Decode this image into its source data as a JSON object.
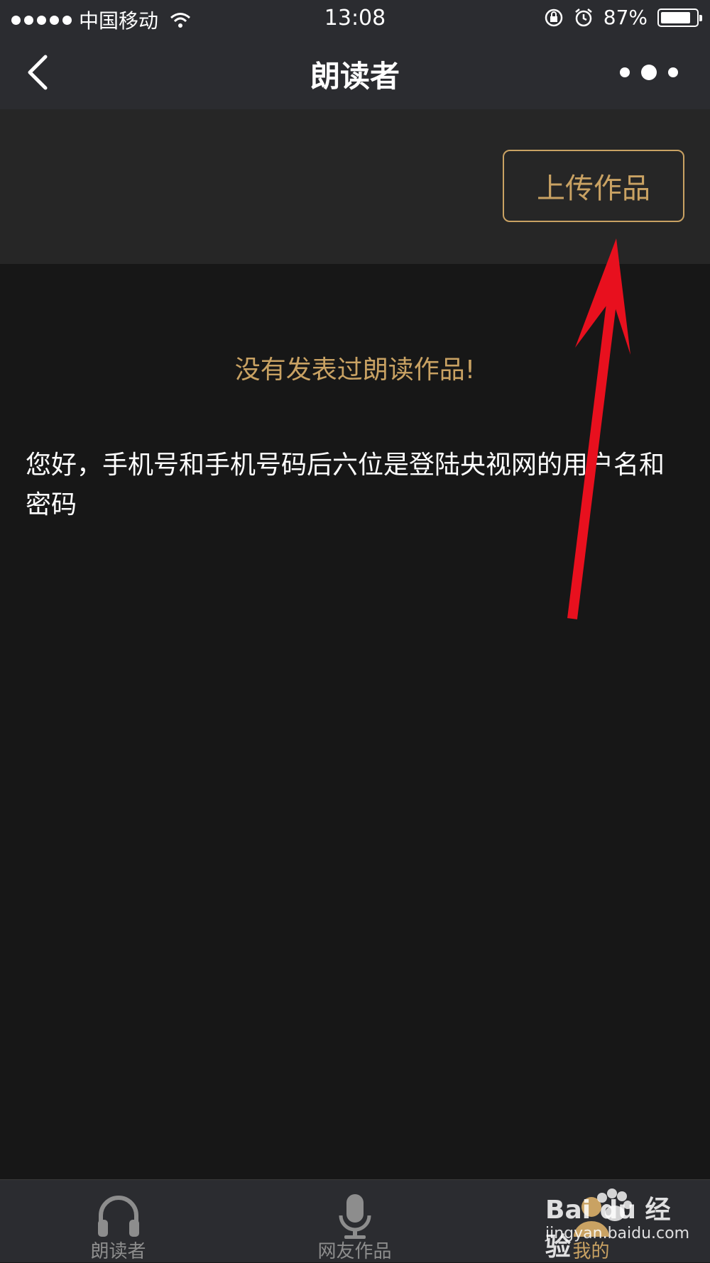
{
  "status_bar": {
    "carrier": "中国移动",
    "time": "13:08",
    "battery_percent": "87%",
    "battery_level": 0.87
  },
  "nav": {
    "title": "朗读者"
  },
  "upload": {
    "label": "上传作品"
  },
  "main": {
    "empty_message": "没有发表过朗读作品!",
    "notice": "您好，手机号和手机号码后六位是登陆央视网的用户名和密码"
  },
  "tabs": [
    {
      "label": "朗读者",
      "icon": "headphones-icon",
      "active": false
    },
    {
      "label": "网友作品",
      "icon": "microphone-icon",
      "active": false
    },
    {
      "label": "我的",
      "icon": "user-icon",
      "active": true
    }
  ],
  "watermark": {
    "brand": "Bai du 经验",
    "url": "jingyan.baidu.com"
  },
  "colors": {
    "accent_gold": "#c9a263",
    "background": "#171717",
    "bar": "#2b2c30",
    "annotation_red": "#e8101e"
  }
}
